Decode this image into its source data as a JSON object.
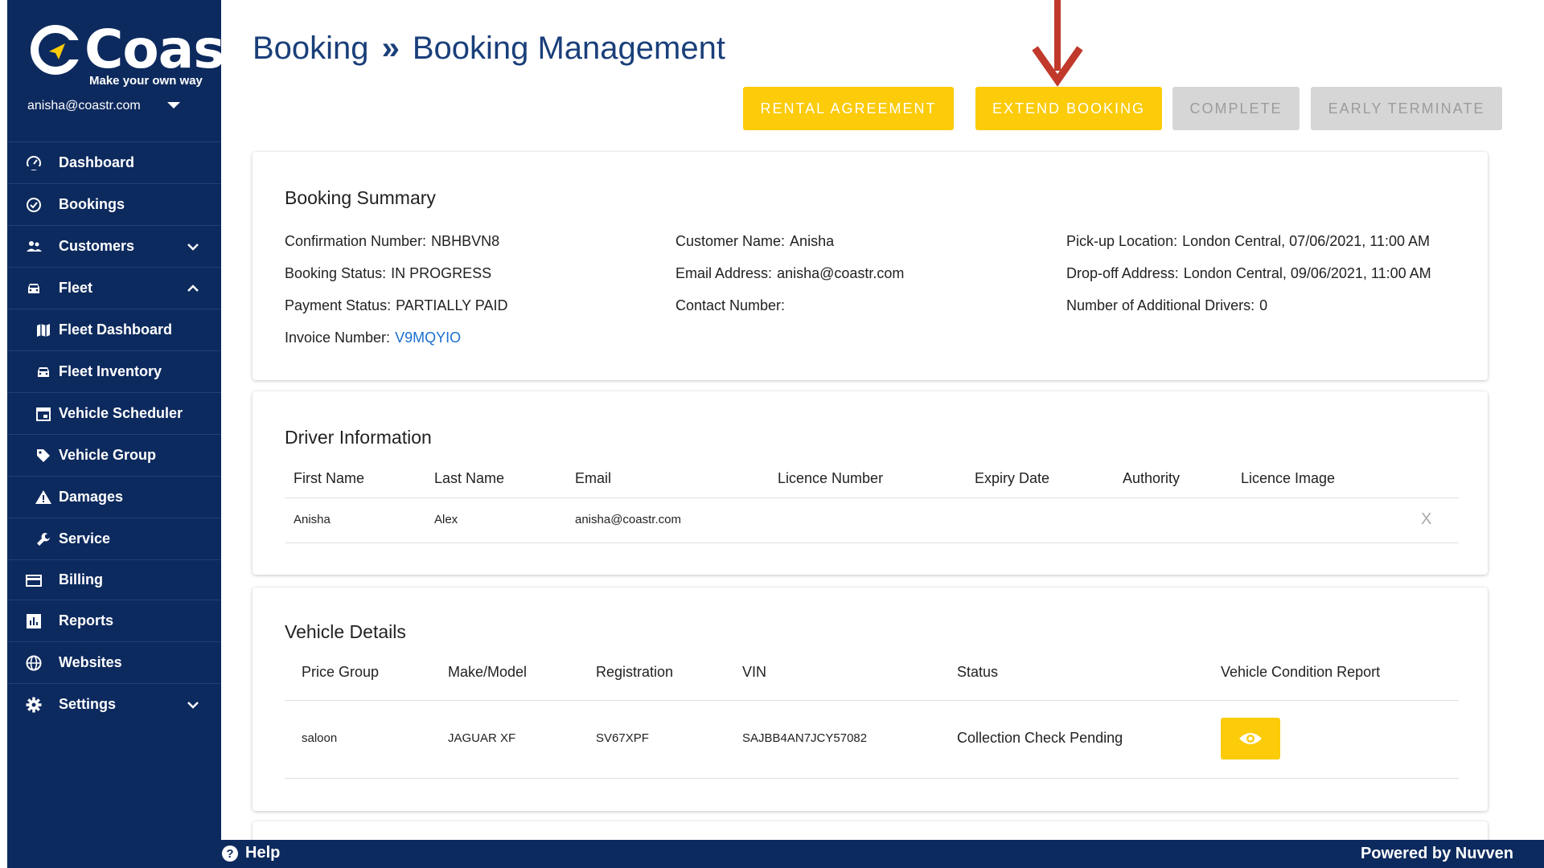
{
  "sidebar": {
    "logo_text": "Coastr",
    "tagline": "Make your own way",
    "user_email": "anisha@coastr.com",
    "items": [
      {
        "label": "Dashboard",
        "icon": "speedometer-icon"
      },
      {
        "label": "Bookings",
        "icon": "check-circle-icon"
      },
      {
        "label": "Customers",
        "icon": "people-icon",
        "chevron": "down"
      },
      {
        "label": "Fleet",
        "icon": "car-icon",
        "chevron": "up"
      },
      {
        "label": "Fleet Dashboard",
        "icon": "map-icon",
        "sub": true
      },
      {
        "label": "Fleet Inventory",
        "icon": "car-icon",
        "sub": true
      },
      {
        "label": "Vehicle Scheduler",
        "icon": "calendar-icon",
        "sub": true
      },
      {
        "label": "Vehicle Group",
        "icon": "tag-icon",
        "sub": true
      },
      {
        "label": "Damages",
        "icon": "warning-icon",
        "sub": true
      },
      {
        "label": "Service",
        "icon": "wrench-icon",
        "sub": true
      },
      {
        "label": "Billing",
        "icon": "credit-card-icon"
      },
      {
        "label": "Reports",
        "icon": "bar-chart-icon"
      },
      {
        "label": "Websites",
        "icon": "globe-icon"
      },
      {
        "label": "Settings",
        "icon": "gear-icon",
        "chevron": "down"
      }
    ]
  },
  "header": {
    "breadcrumb_root": "Booking",
    "breadcrumb_sep": "»",
    "breadcrumb_current": "Booking Management"
  },
  "actions": {
    "rental_agreement": "RENTAL AGREEMENT",
    "extend_booking": "EXTEND BOOKING",
    "complete": "COMPLETE",
    "early_terminate": "EARLY TERMINATE"
  },
  "colors": {
    "sidebar_bg": "#0d2a5e",
    "accent_yellow": "#fccb0a",
    "disabled_grey": "#d6d6d6",
    "arrow_red": "#c0392b",
    "link_blue": "#1a6fd1"
  },
  "summary": {
    "title": "Booking Summary",
    "confirmation_label": "Confirmation Number:",
    "confirmation_value": "NBHBVN8",
    "status_label": "Booking Status:",
    "status_value": "IN PROGRESS",
    "payment_label": "Payment Status:",
    "payment_value": "PARTIALLY PAID",
    "invoice_label": "Invoice Number:",
    "invoice_value": "V9MQYIO",
    "customer_label": "Customer Name:",
    "customer_value": "Anisha",
    "email_label": "Email Address:",
    "email_value": "anisha@coastr.com",
    "contact_label": "Contact Number:",
    "contact_value": "",
    "pickup_label": "Pick-up Location:",
    "pickup_value": "London Central, 07/06/2021, 11:00 AM",
    "dropoff_label": "Drop-off Address:",
    "dropoff_value": "London Central, 09/06/2021, 11:00 AM",
    "additional_label": "Number of Additional Drivers:",
    "additional_value": "0"
  },
  "driver": {
    "title": "Driver Information",
    "columns": [
      "First Name",
      "Last Name",
      "Email",
      "Licence Number",
      "Expiry Date",
      "Authority",
      "Licence Image"
    ],
    "row": {
      "first": "Anisha",
      "last": "Alex",
      "email": "anisha@coastr.com",
      "remove": "X"
    }
  },
  "vehicle": {
    "title": "Vehicle Details",
    "columns": [
      "Price Group",
      "Make/Model",
      "Registration",
      "VIN",
      "Status",
      "Vehicle Condition Report"
    ],
    "row": {
      "price_group": "saloon",
      "make_model": "JAGUAR XF",
      "registration": "SV67XPF",
      "vin": "SAJBB4AN7JCY57082",
      "status": "Collection Check Pending"
    }
  },
  "footer": {
    "help": "Help",
    "powered": "Powered by Nuvven"
  }
}
